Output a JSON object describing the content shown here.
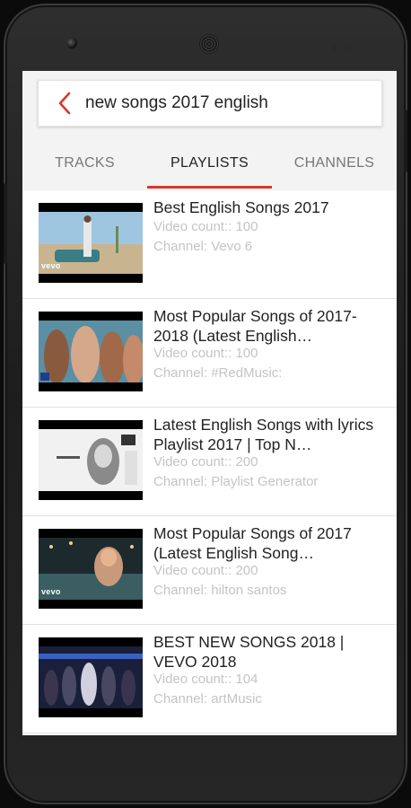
{
  "search": {
    "query": "new songs 2017 english"
  },
  "tabs": [
    {
      "label": "TRACKS"
    },
    {
      "label": "PLAYLISTS"
    },
    {
      "label": "CHANNELS"
    }
  ],
  "active_tab": "PLAYLISTS",
  "colors": {
    "accent": "#d9382a",
    "meta_text": "#c4c4c4"
  },
  "playlists": [
    {
      "title": "Best English Songs 2017",
      "video_count": "Video count:: 100",
      "channel": "Channel: Vevo 6",
      "thumb_logo": "vevo"
    },
    {
      "title": "Most Popular Songs of 2017-2018 (Latest English…",
      "video_count": "Video count:: 100",
      "channel": "Channel: #RedMusic:",
      "thumb_logo": ""
    },
    {
      "title": "Latest English Songs with lyrics Playlist 2017 | Top N…",
      "video_count": "Video count:: 200",
      "channel": "Channel: Playlist Generator",
      "thumb_logo": ""
    },
    {
      "title": "Most Popular Songs of 2017 (Latest English Song…",
      "video_count": "Video count:: 200",
      "channel": "Channel: hilton santos",
      "thumb_logo": "vevo"
    },
    {
      "title": "BEST NEW SONGS 2018 | VEVO 2018",
      "video_count": "Video count:: 104",
      "channel": "Channel: artMusic",
      "thumb_logo": ""
    }
  ]
}
